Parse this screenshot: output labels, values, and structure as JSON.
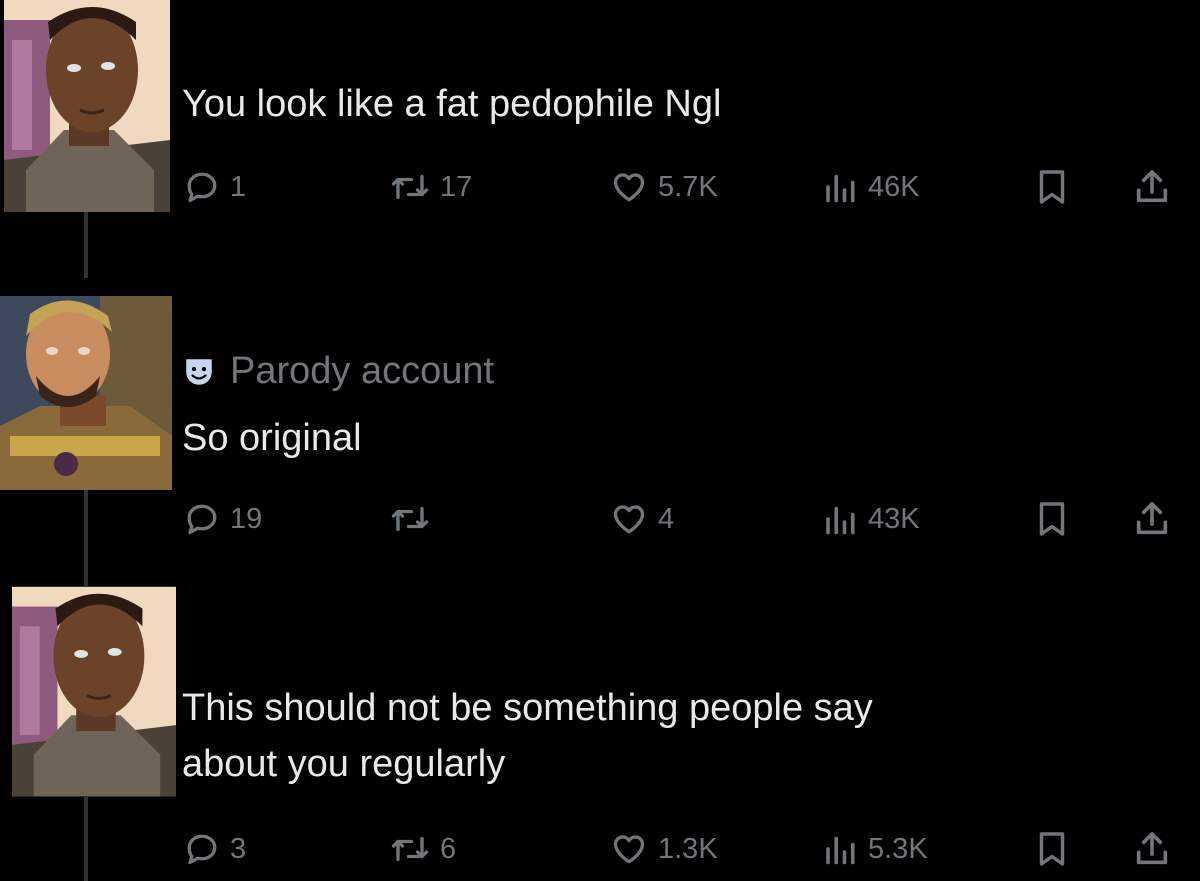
{
  "tweets": [
    {
      "text": "You look like a fat pedophile Ngl",
      "avatar_icon": "character-portrait-avatar",
      "reply_count": "1",
      "retweet_count": "17",
      "like_count": "5.7K",
      "view_count": "46K"
    },
    {
      "badge_label": "Parody account",
      "badge_icon": "parody-mask-icon",
      "text": "So original",
      "avatar_icon": "character-portrait-avatar",
      "reply_count": "19",
      "retweet_count": "",
      "like_count": "4",
      "view_count": "43K"
    },
    {
      "text": "This should not be something people say\nabout you regularly",
      "avatar_icon": "character-portrait-avatar",
      "reply_count": "3",
      "retweet_count": "6",
      "like_count": "1.3K",
      "view_count": "5.3K"
    }
  ],
  "colors": {
    "background": "#000000",
    "text": "#e7e9ea",
    "muted": "#71767b",
    "thread_line": "#2f3336"
  }
}
